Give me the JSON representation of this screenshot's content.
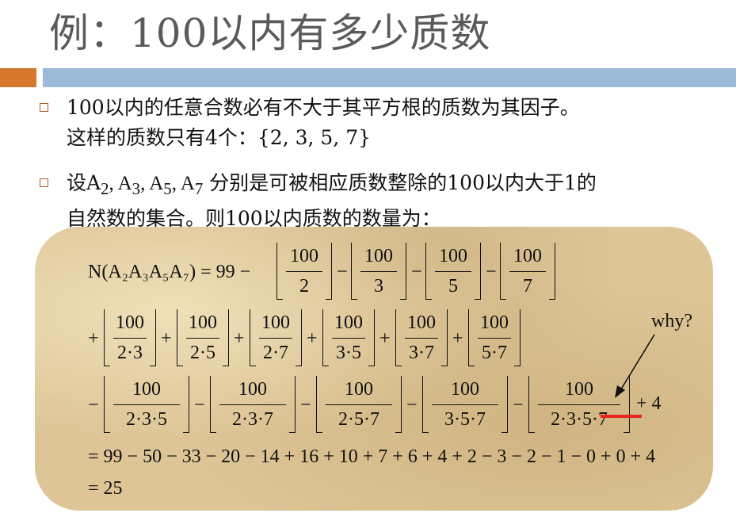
{
  "title": "例：100以内有多少质数",
  "colors": {
    "accent_orange": "#d8772e",
    "accent_blue": "#9dbad8",
    "red_mark": "#e8261e"
  },
  "bullets": [
    {
      "icon": "square-bullet-icon",
      "line1": "100以内的任意合数必有不大于其平方根的质数为其因子。",
      "line2": "这样的质数只有4个：{2, 3, 5, 7}"
    },
    {
      "icon": "square-bullet-icon",
      "line1_pre": "设A",
      "line1_post": " 分别是可被相应质数整除的100以内大于1的",
      "line2": "自然数的集合。则100以内质数的数量为："
    }
  ],
  "formula": {
    "lhs": "N(A₂A₃A₅A₇) = 99 −",
    "row1": {
      "ops": [
        "−",
        "−",
        "−"
      ],
      "fractions": [
        [
          "100",
          "2"
        ],
        [
          "100",
          "3"
        ],
        [
          "100",
          "5"
        ],
        [
          "100",
          "7"
        ]
      ]
    },
    "row2": {
      "ops": [
        "+",
        "+",
        "+",
        "+",
        "+",
        "+"
      ],
      "fractions": [
        [
          "100",
          "2·3"
        ],
        [
          "100",
          "2·5"
        ],
        [
          "100",
          "2·7"
        ],
        [
          "100",
          "3·5"
        ],
        [
          "100",
          "3·7"
        ],
        [
          "100",
          "5·7"
        ]
      ]
    },
    "row3": {
      "ops": [
        "−",
        "−",
        "−",
        "−",
        "+"
      ],
      "fractions": [
        [
          "100",
          "2·3·5"
        ],
        [
          "100",
          "2·3·7"
        ],
        [
          "100",
          "2·5·7"
        ],
        [
          "100",
          "3·5·7"
        ],
        [
          "100",
          "2·3·5·7"
        ]
      ],
      "tail": "+ 4"
    },
    "row4": "= 99 − 50 − 33 − 20 − 14 + 16 + 10 + 7 + 6 + 4 + 2 − 3 − 2 − 1 − 0 + 0 + 4",
    "row5": "= 25"
  },
  "annotation": "why?"
}
